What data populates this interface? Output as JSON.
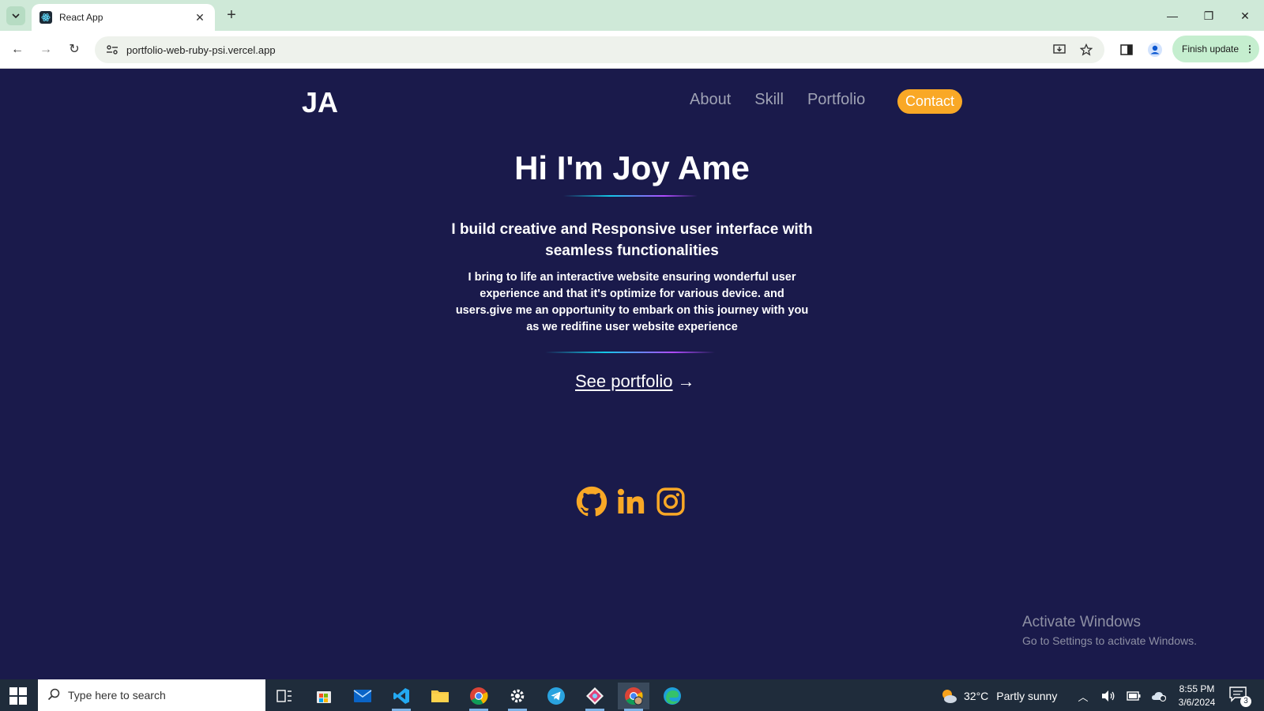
{
  "browser": {
    "tab_title": "React App",
    "url": "portfolio-web-ruby-psi.vercel.app",
    "finish_update_label": "Finish update"
  },
  "site": {
    "logo": "JA",
    "nav": [
      {
        "label": "About"
      },
      {
        "label": "Skill"
      },
      {
        "label": "Portfolio"
      }
    ],
    "contact_label": "Contact",
    "hero_title": "Hi I'm Joy Ame",
    "subtitle": "I build creative and Responsive user interface with seamless functionalities",
    "description": "I bring to life an interactive website ensuring wonderful user experience and that it's optimize for various device. and users.give me an opportunity to embark on this journey with you as we redifine user website experience",
    "see_portfolio_label": "See portfolio",
    "arrow": "→",
    "socials": [
      {
        "icon": "github-icon"
      },
      {
        "icon": "linkedin-icon"
      },
      {
        "icon": "instagram-icon"
      }
    ],
    "colors": {
      "background": "#1a1a4b",
      "accent": "#f9a826",
      "nav_text": "#9fa2b4"
    }
  },
  "watermark": {
    "line1": "Activate Windows",
    "line2": "Go to Settings to activate Windows."
  },
  "taskbar": {
    "search_placeholder": "Type here to search",
    "weather_temp": "32°C",
    "weather_condition": "Partly sunny",
    "time": "8:55 PM",
    "date": "3/6/2024",
    "notification_count": "3"
  }
}
